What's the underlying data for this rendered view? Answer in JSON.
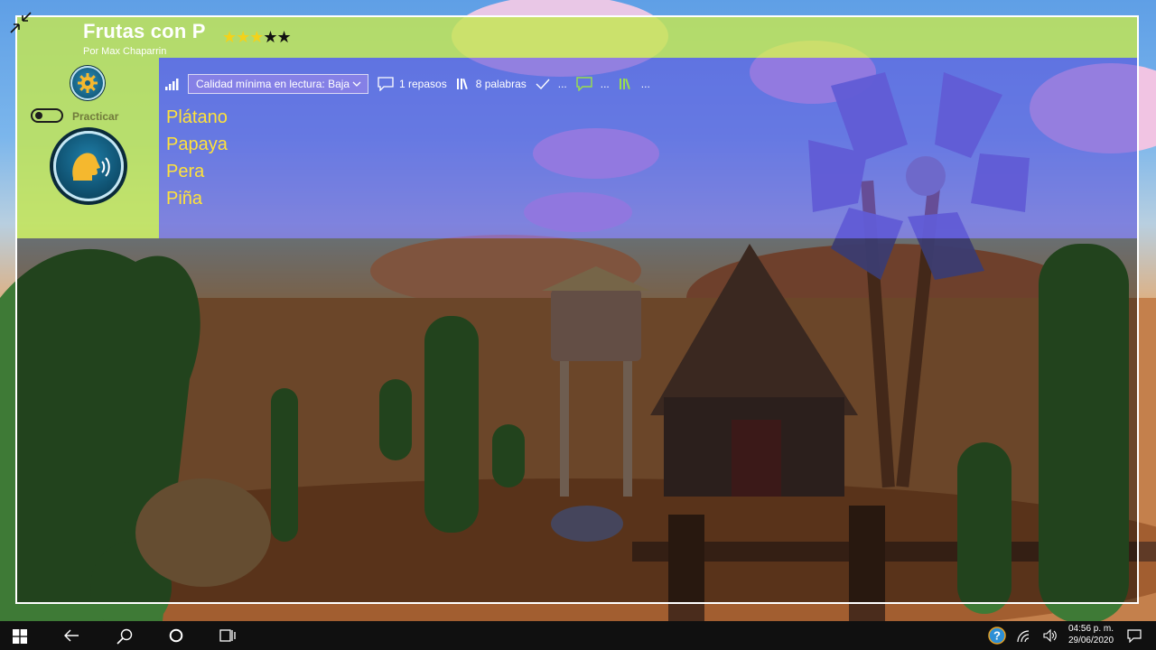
{
  "app": {
    "title": "Frutas con P",
    "author": "Por Max Chaparrin",
    "rating": 3,
    "rating_max": 5,
    "stars_on": "★★★",
    "stars_off": "★★"
  },
  "sidebar": {
    "settings_icon": "gear-icon",
    "practice_label": "Practicar",
    "practice_toggle": false,
    "speak_icon": "speaking-head-icon"
  },
  "toolbar": {
    "quality_select": "Calidad mínima en lectura: Baja",
    "reviews": "1 repasos",
    "words_count": "8 palabras",
    "dots": "..."
  },
  "words": [
    "Plátano",
    "Papaya",
    "Pera",
    "Piña"
  ],
  "taskbar": {
    "time": "04:56 p. m.",
    "date": "29/06/2020"
  },
  "colors": {
    "header": "#c4e650",
    "content": "#5850dc",
    "word": "#ffe23a",
    "accent_green": "#9be04a"
  }
}
